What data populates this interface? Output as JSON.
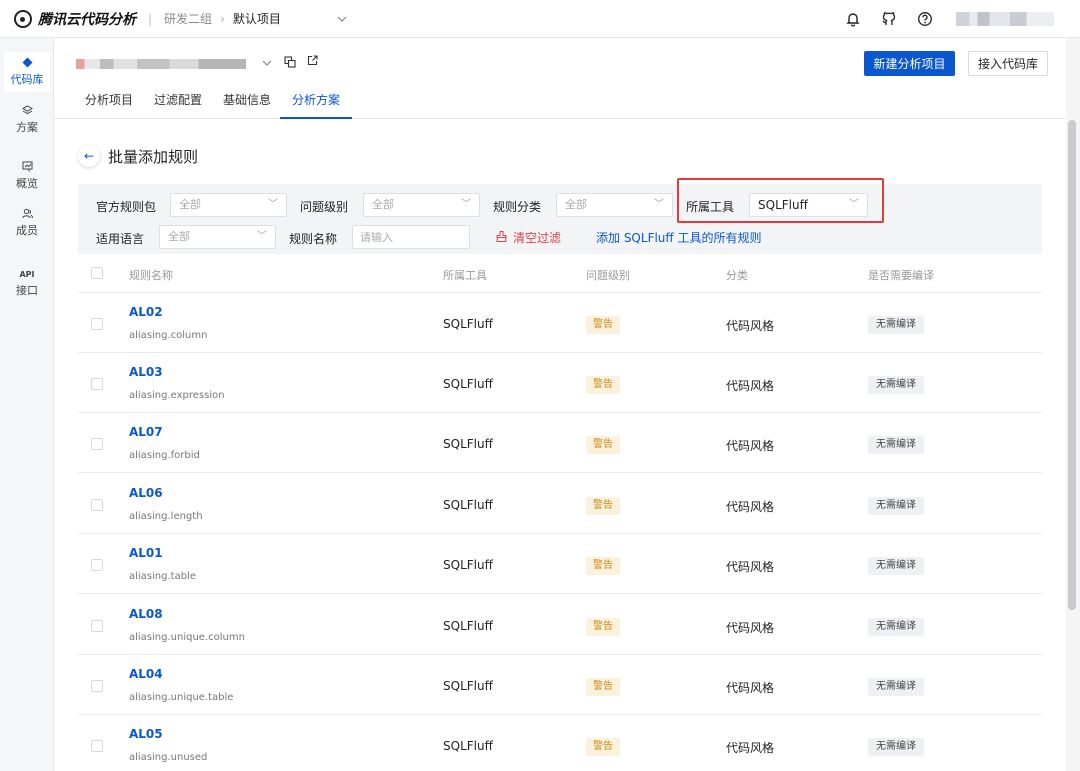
{
  "topbar": {
    "brand": "腾讯云代码分析",
    "sep": "|",
    "breadcrumb_team": "研发二组",
    "breadcrumb_arrow": "›",
    "breadcrumb_project": "默认项目"
  },
  "sidebar": {
    "items": [
      {
        "label": "代码库",
        "icon": "diamond-icon"
      },
      {
        "label": "方案",
        "icon": "layers-icon"
      },
      {
        "label": "概览",
        "icon": "chart-icon"
      },
      {
        "label": "成员",
        "icon": "user-icon"
      },
      {
        "label": "接口",
        "icon_text": "API"
      }
    ]
  },
  "project": {
    "new_button": "新建分析项目",
    "connect_button": "接入代码库"
  },
  "tabs": [
    {
      "label": "分析项目"
    },
    {
      "label": "过滤配置"
    },
    {
      "label": "基础信息"
    },
    {
      "label": "分析方案",
      "active": true
    }
  ],
  "page": {
    "back": "←",
    "title": "批量添加规则"
  },
  "filters": {
    "official_pack_label": "官方规则包",
    "official_pack_value": "全部",
    "level_label": "问题级别",
    "level_value": "全部",
    "category_label": "规则分类",
    "category_value": "全部",
    "tool_label": "所属工具",
    "tool_value": "SQLFluff",
    "lang_label": "适用语言",
    "lang_value": "全部",
    "name_label": "规则名称",
    "name_placeholder": "请输入",
    "clear_link": "清空过滤",
    "add_all_link": "添加 SQLFluff 工具的所有规则"
  },
  "table": {
    "headers": [
      "规则名称",
      "所属工具",
      "问题级别",
      "分类",
      "是否需要编译"
    ],
    "rows": [
      {
        "code": "AL02",
        "desc": "aliasing.column",
        "tool": "SQLFluff",
        "level": "警告",
        "category": "代码风格",
        "compile": "无需编译"
      },
      {
        "code": "AL03",
        "desc": "aliasing.expression",
        "tool": "SQLFluff",
        "level": "警告",
        "category": "代码风格",
        "compile": "无需编译"
      },
      {
        "code": "AL07",
        "desc": "aliasing.forbid",
        "tool": "SQLFluff",
        "level": "警告",
        "category": "代码风格",
        "compile": "无需编译"
      },
      {
        "code": "AL06",
        "desc": "aliasing.length",
        "tool": "SQLFluff",
        "level": "警告",
        "category": "代码风格",
        "compile": "无需编译"
      },
      {
        "code": "AL01",
        "desc": "aliasing.table",
        "tool": "SQLFluff",
        "level": "警告",
        "category": "代码风格",
        "compile": "无需编译"
      },
      {
        "code": "AL08",
        "desc": "aliasing.unique.column",
        "tool": "SQLFluff",
        "level": "警告",
        "category": "代码风格",
        "compile": "无需编译"
      },
      {
        "code": "AL04",
        "desc": "aliasing.unique.table",
        "tool": "SQLFluff",
        "level": "警告",
        "category": "代码风格",
        "compile": "无需编译"
      },
      {
        "code": "AL05",
        "desc": "aliasing.unused",
        "tool": "SQLFluff",
        "level": "警告",
        "category": "代码风格",
        "compile": "无需编译"
      }
    ]
  },
  "colors": {
    "primary": "#0b57d0",
    "danger": "#e0424b",
    "warning_bg": "#fbf1dd",
    "warning_text": "#c98a12"
  }
}
